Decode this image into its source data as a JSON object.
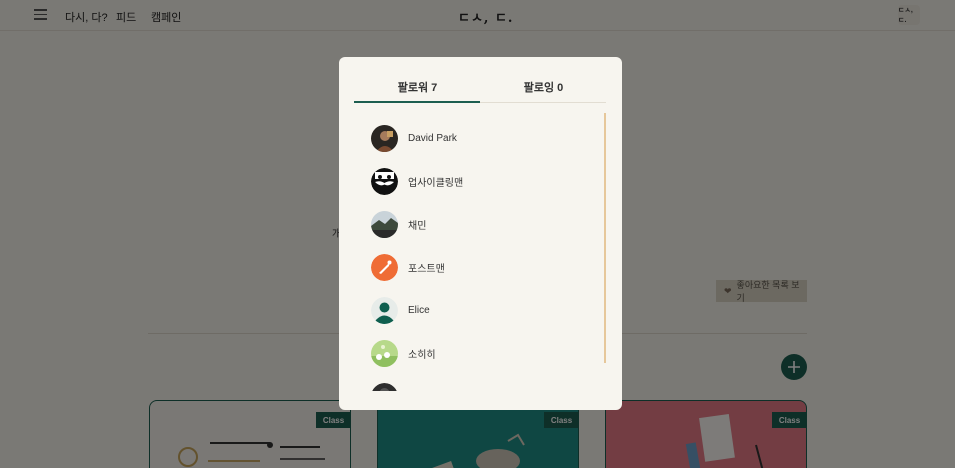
{
  "header": {
    "nav": [
      "다시, 다?",
      "피드",
      "캠페인"
    ],
    "logo": "ㄷㅅ, ㄷ.",
    "account_badge": "ㄷㅅ, ㄷ."
  },
  "background": {
    "text_left": "개",
    "text_right": ")",
    "liked_button": "좋아요한 목록 보기",
    "card_badge": "Class"
  },
  "modal": {
    "tabs": [
      {
        "label": "팔로워 7",
        "active": true
      },
      {
        "label": "팔로잉 0",
        "active": false
      }
    ],
    "followers": [
      {
        "name": "David Park",
        "avatar": "photo-portrait"
      },
      {
        "name": "업사이클링맨",
        "avatar": "mustache-face-icon"
      },
      {
        "name": "채민",
        "avatar": "landscape-photo"
      },
      {
        "name": "포스트맨",
        "avatar": "postman-rocket-icon"
      },
      {
        "name": "Elice",
        "avatar": "default-user-icon"
      },
      {
        "name": "소히히",
        "avatar": "illustration-photo"
      },
      {
        "name": "",
        "avatar": "dark-photo"
      }
    ]
  },
  "colors": {
    "accent": "#1d5e50",
    "background": "#f5f2ea",
    "modal": "#f7f5ef",
    "scrollbar": "#e6c79a"
  }
}
